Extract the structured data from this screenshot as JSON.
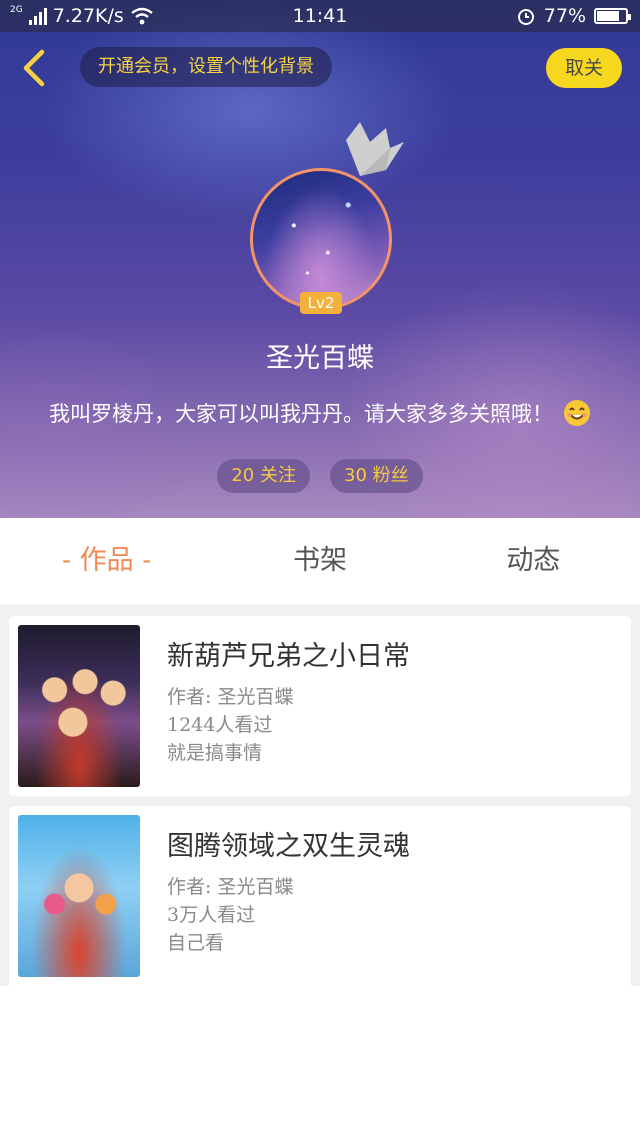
{
  "status_bar": {
    "network": "2G",
    "speed": "7.27K/s",
    "time": "11:41",
    "battery": "77%",
    "battery_level": 0.77
  },
  "header": {
    "promo_text": "开通会员，设置个性化背景",
    "unfollow_label": "取关"
  },
  "profile": {
    "level": "Lv2",
    "username": "圣光百蝶",
    "bio": "我叫罗棱丹，大家可以叫我丹丹。请大家多多关照哦！",
    "following": "20 关注",
    "followers": "30 粉丝"
  },
  "tabs": [
    {
      "label": "- 作品 -",
      "active": true
    },
    {
      "label": "书架",
      "active": false
    },
    {
      "label": "动态",
      "active": false
    }
  ],
  "works": [
    {
      "title": "新葫芦兄弟之小日常",
      "author": "作者: 圣光百蝶",
      "views": "1244人看过",
      "desc": "就是搞事情"
    },
    {
      "title": "图腾领域之双生灵魂",
      "author": "作者: 圣光百蝶",
      "views": "3万人看过",
      "desc": "自己看"
    }
  ],
  "colors": {
    "accent_orange": "#ee8a55",
    "promo_yellow": "#f6d342",
    "button_yellow": "#f8d81f"
  }
}
